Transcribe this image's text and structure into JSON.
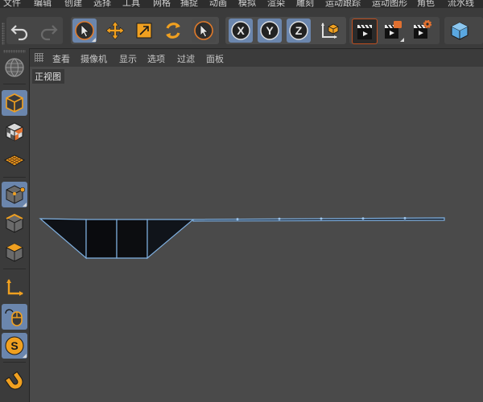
{
  "menu": {
    "items": [
      "文件",
      "编辑",
      "创建",
      "选择",
      "工具",
      "网格",
      "捕捉",
      "动画",
      "模拟",
      "渲染",
      "雕刻",
      "运动跟踪",
      "运动图形",
      "角色",
      "流水线"
    ]
  },
  "toolbar": {
    "undo_icon": "undo-icon",
    "redo_icon": "redo-icon",
    "axis_x": "X",
    "axis_y": "Y",
    "axis_z": "Z"
  },
  "viewport_menu": {
    "items": [
      "查看",
      "摄像机",
      "显示",
      "选项",
      "过滤",
      "面板"
    ]
  },
  "viewport": {
    "label": "正视图"
  },
  "colors": {
    "accent": "#6b86ad",
    "icon_orange": "#f0a020",
    "viewport_bg": "#4a4a4a",
    "mesh_edge": "#7fb0e0"
  }
}
